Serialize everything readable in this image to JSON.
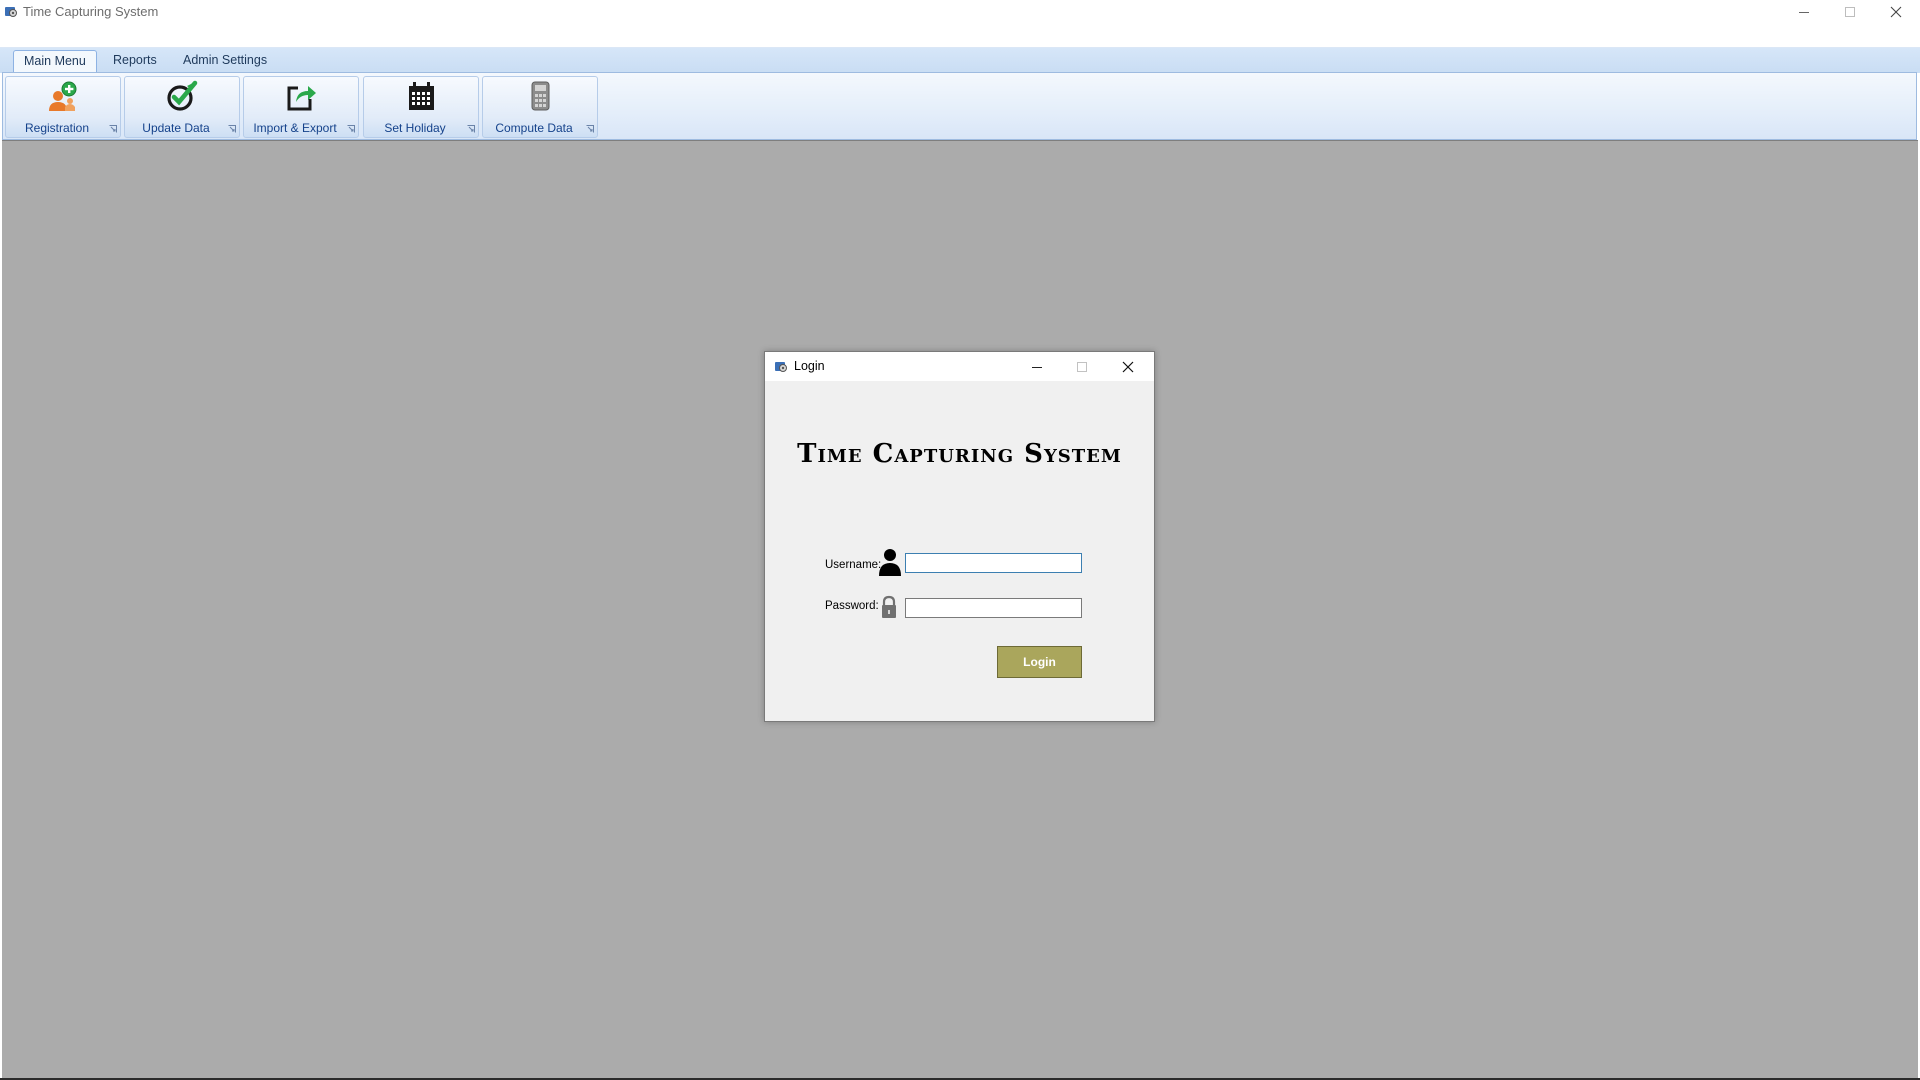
{
  "window": {
    "title": "Time Capturing System",
    "icon": "app-gear-icon"
  },
  "ribbon": {
    "tabs": [
      {
        "label": "Main Menu",
        "active": true
      },
      {
        "label": "Reports",
        "active": false
      },
      {
        "label": "Admin Settings",
        "active": false
      }
    ],
    "groups": [
      {
        "label": "Registration",
        "icon": "add-user-icon"
      },
      {
        "label": "Update Data",
        "icon": "edit-check-icon"
      },
      {
        "label": "Import & Export",
        "icon": "share-export-icon"
      },
      {
        "label": "Set Holiday",
        "icon": "calendar-icon"
      },
      {
        "label": "Compute Data",
        "icon": "calculator-icon"
      }
    ]
  },
  "login": {
    "title": "Login",
    "banner": "Time Capturing System",
    "username_label": "Username:",
    "username_value": "",
    "password_label": "Password:",
    "password_value": "",
    "button_label": "Login"
  },
  "colors": {
    "mdi_background": "#ababab",
    "login_button": "#aaa65c",
    "ribbon_text": "#15428b"
  }
}
